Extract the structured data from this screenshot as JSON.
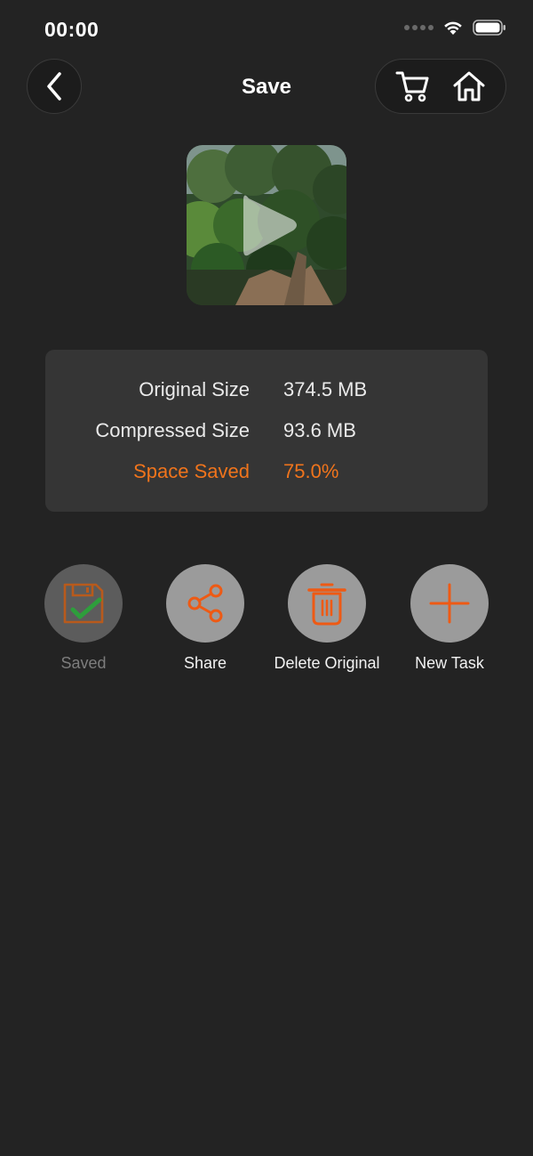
{
  "status_bar": {
    "time": "00:00"
  },
  "nav": {
    "title": "Save"
  },
  "colors": {
    "accent": "#f0741c",
    "background": "#232323",
    "card": "#353535"
  },
  "stats": [
    {
      "label": "Original Size",
      "value": "374.5 MB"
    },
    {
      "label": "Compressed Size",
      "value": "93.6 MB"
    },
    {
      "label": "Space Saved",
      "value": "75.0%"
    }
  ],
  "actions": [
    {
      "label": "Saved",
      "icon": "save-check-icon",
      "disabled": true
    },
    {
      "label": "Share",
      "icon": "share-icon"
    },
    {
      "label": "Delete Original",
      "icon": "trash-icon"
    },
    {
      "label": "New Task",
      "icon": "plus-icon"
    }
  ]
}
